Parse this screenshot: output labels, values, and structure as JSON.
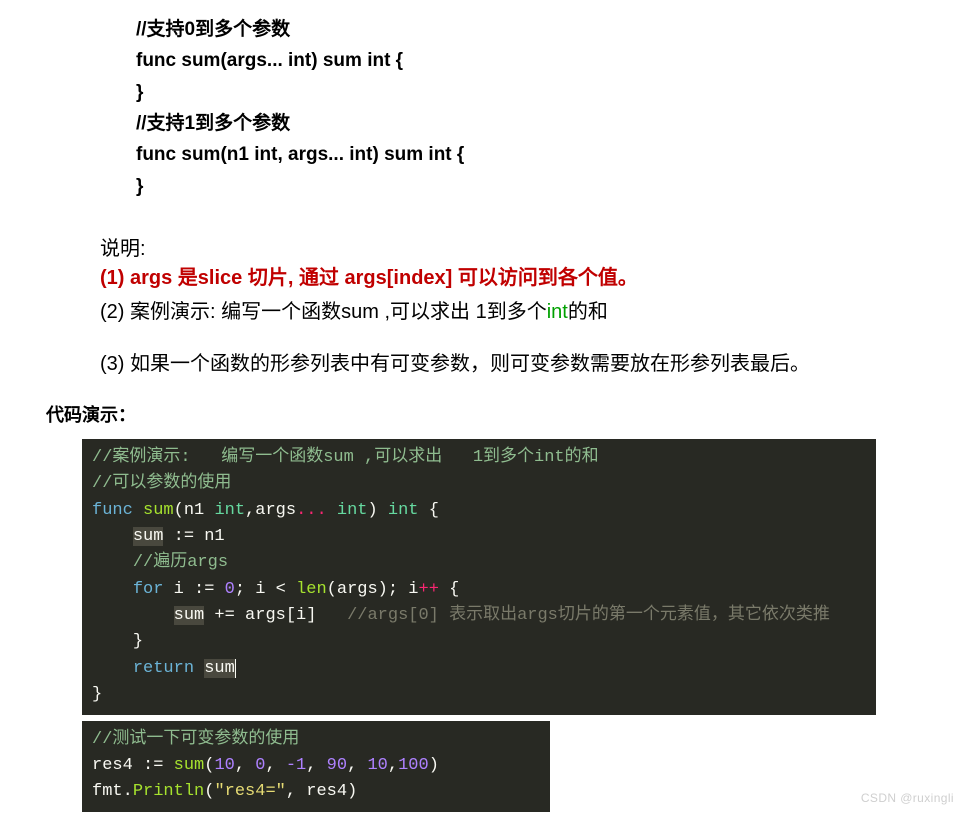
{
  "syntax": {
    "c1": "//支持0到多个参数",
    "c2": "func sum(args... int) sum int {",
    "c3": "}",
    "c4": "//支持1到多个参数",
    "c5": "func sum(n1 int, args... int) sum int {",
    "c6": "}"
  },
  "explain": {
    "label": "说明:",
    "i1": "(1)  args 是slice 切片, 通过 args[index]  可以访问到各个值。",
    "i2a": "(2)  案例演示:    编写一个函数sum ,可以求出  1到多个",
    "i2b": "int",
    "i2c": "的和",
    "i3": "(3)  如果一个函数的形参列表中有可变参数，则可变参数需要放在形参列表最后。"
  },
  "section": "代码演示：",
  "code1": {
    "l1": "//案例演示:   编写一个函数sum ,可以求出   1到多个int的和",
    "l2": "//可以参数的使用",
    "l3a": "func",
    "l3b": "sum",
    "l3c": "(n1 ",
    "l3d": "int",
    "l3e": ",args",
    "l3f": "...",
    "l3g": "int",
    "l3h": ") ",
    "l3i": "int",
    "l3j": " {",
    "l4a": "sum",
    "l4b": " := n1",
    "l5": "//遍历args",
    "l6a": "for",
    "l6b": " i := ",
    "l6c": "0",
    "l6d": "; i < ",
    "l6e": "len",
    "l6f": "(args); i",
    "l6g": "++",
    "l6h": " {",
    "l7a": "sum",
    "l7b": " += args[i]   ",
    "l7c": "//args[0] 表示取出args切片的第一个元素值，其它依次类推",
    "l8": "}",
    "l9a": "return",
    "l9b": "sum",
    "l10": "}"
  },
  "code2": {
    "l1": "//测试一下可变参数的使用",
    "l2a": "res4 := ",
    "l2b": "sum",
    "l2c": "(",
    "l2d": "10",
    "l2e": ", ",
    "l2f": "0",
    "l2g": ", ",
    "l2h": "-1",
    "l2i": ", ",
    "l2j": "90",
    "l2k": ", ",
    "l2l": "10",
    "l2m": ",",
    "l2n": "100",
    "l2o": ")",
    "l3a": "fmt.",
    "l3b": "Println",
    "l3c": "(",
    "l3d": "\"res4=\"",
    "l3e": ", res4)"
  },
  "watermark": "CSDN @ruxingli"
}
